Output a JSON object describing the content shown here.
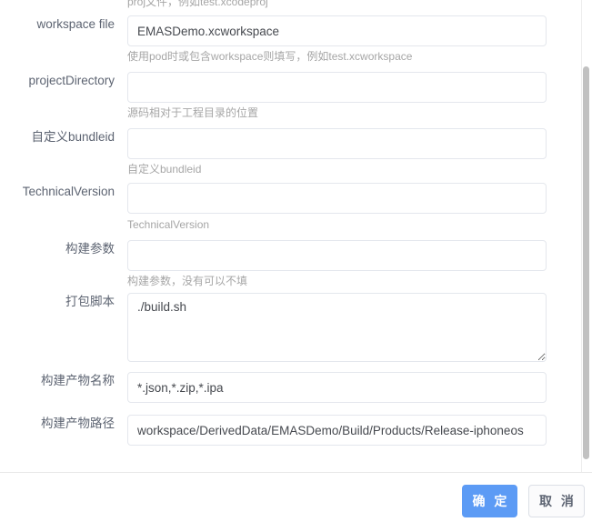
{
  "dialog": {
    "clipped_top_hint": "proj文件，例如test.xcodeproj",
    "fields": [
      {
        "label": "workspace file",
        "type": "input",
        "value": "EMASDemo.xcworkspace",
        "placeholder": "",
        "hint": "使用pod时或包含workspace则填写，例如test.xcworkspace"
      },
      {
        "label": "projectDirectory",
        "type": "input",
        "value": "",
        "placeholder": "",
        "hint": "源码相对于工程目录的位置"
      },
      {
        "label": "自定义bundleid",
        "type": "input",
        "value": "",
        "placeholder": "",
        "hint": "自定义bundleid"
      },
      {
        "label": "TechnicalVersion",
        "type": "input",
        "value": "",
        "placeholder": "",
        "hint": "TechnicalVersion"
      },
      {
        "label": "构建参数",
        "type": "input",
        "value": "",
        "placeholder": "",
        "hint": "构建参数，没有可以不填"
      },
      {
        "label": "打包脚本",
        "type": "textarea",
        "value": "./build.sh",
        "placeholder": "",
        "hint": ""
      },
      {
        "label": "构建产物名称",
        "type": "input",
        "value": "*.json,*.zip,*.ipa",
        "placeholder": "",
        "hint": ""
      },
      {
        "label": "构建产物路径",
        "type": "input",
        "value": "workspace/DerivedData/EMASDemo/Build/Products/Release-iphoneos",
        "placeholder": "",
        "hint": ""
      }
    ],
    "footer": {
      "confirm_label": "确 定",
      "cancel_label": "取 消"
    },
    "colors": {
      "primary": "#5c9bf5",
      "label_text": "#5d6472",
      "hint_text": "#a6a6a6",
      "input_border": "#e4e7ed",
      "scrollbar_thumb": "#c1c1c1"
    }
  }
}
